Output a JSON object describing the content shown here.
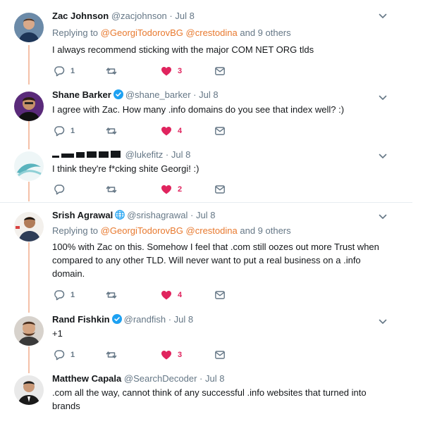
{
  "colors": {
    "accent": "#e8792e",
    "like": "#e0245e",
    "verified": "#1da1f2",
    "thread": "#f4c1a8"
  },
  "tweets": [
    {
      "name": "Zac Johnson",
      "handle": "@zacjohnson",
      "dot": "·",
      "date": "Jul 8",
      "reply_prefix": "Replying to",
      "mention1": "@GeorgiTodorovBG",
      "mention2": "@crestodina",
      "reply_suffix": "and 9 others",
      "text": "I always recommend sticking with the major COM NET ORG tlds",
      "replies": "1",
      "likes": "3"
    },
    {
      "name": "Shane Barker",
      "handle": "@shane_barker",
      "dot": "·",
      "date": "Jul 8",
      "text": "I agree with Zac.  How many .info domains do you see that index well? :)",
      "replies": "1",
      "likes": "4"
    },
    {
      "handle": "@lukefitz",
      "dot": "·",
      "date": "Jul 8",
      "text": "I think they're f*cking shite Georgi! :)",
      "replies": "",
      "likes": "2"
    },
    {
      "name": "Srish Agrawal",
      "handle": "@srishagrawal",
      "dot": "·",
      "date": "Jul 8",
      "reply_prefix": "Replying to",
      "mention1": "@GeorgiTodorovBG",
      "mention2": "@crestodina",
      "reply_suffix": "and 9 others",
      "text": "100% with Zac on this. Somehow I feel that .com still oozes out more Trust when compared to any other TLD. Will never want to put a real business on a .info domain.",
      "replies": "1",
      "likes": "4"
    },
    {
      "name": "Rand Fishkin",
      "handle": "@randfish",
      "dot": "·",
      "date": "Jul 8",
      "text": "+1",
      "replies": "1",
      "likes": "3"
    },
    {
      "name": "Matthew Capala",
      "handle": "@SearchDecoder",
      "dot": "·",
      "date": "Jul 8",
      "text": ".com all the way, cannot think of any successful .info websites that turned into brands"
    }
  ]
}
